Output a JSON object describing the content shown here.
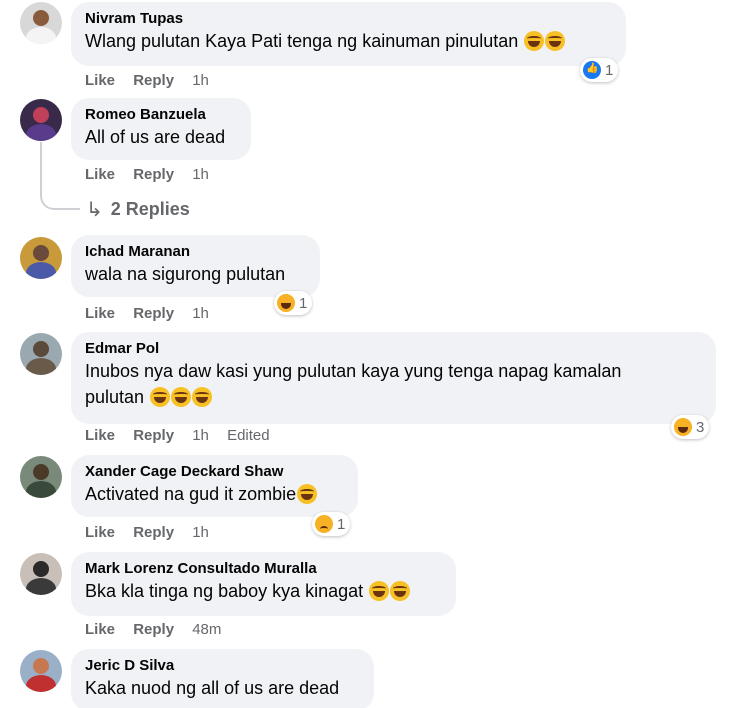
{
  "comments": [
    {
      "name": "Nivram Tupas",
      "text": "Wlang pulutan Kaya Pati tenga ng kainuman pinulutan",
      "emojis": 2,
      "like": "Like",
      "reply": "Reply",
      "time": "1h",
      "reaction": {
        "icon": "like-icon",
        "count": "1"
      }
    },
    {
      "name": "Romeo Banzuela",
      "text": "All of us are dead",
      "emojis": 0,
      "like": "Like",
      "reply": "Reply",
      "time": "1h",
      "replies_label": "2 Replies"
    },
    {
      "name": "Ichad Maranan",
      "text": "wala na sigurong pulutan",
      "emojis": 0,
      "like": "Like",
      "reply": "Reply",
      "time": "1h",
      "reaction": {
        "icon": "haha-icon",
        "count": "1"
      }
    },
    {
      "name": "Edmar Pol",
      "text_line1": "Inubos nya daw kasi yung pulutan kaya yung tenga napag kamalan",
      "text_line2": "pulutan",
      "emojis": 3,
      "like": "Like",
      "reply": "Reply",
      "time": "1h",
      "edited": "Edited",
      "reaction": {
        "icon": "haha-icon",
        "count": "3"
      }
    },
    {
      "name": "Xander Cage Deckard Shaw",
      "text": "Activated na gud it zombie",
      "emojis": 1,
      "like": "Like",
      "reply": "Reply",
      "time": "1h",
      "reaction": {
        "icon": "sad-icon",
        "count": "1"
      }
    },
    {
      "name": "Mark Lorenz Consultado Muralla",
      "text": "Bka kla tinga ng baboy kya kinagat",
      "emojis": 2,
      "like": "Like",
      "reply": "Reply",
      "time": "48m"
    },
    {
      "name": "Jeric D Silva",
      "text": "Kaka nuod ng all of us are dead"
    }
  ],
  "colors": {
    "bubble": "#f0f2f5",
    "meta": "#65676b",
    "like_blue": "#1877f2",
    "emoji_yellow": "#f7b125"
  }
}
